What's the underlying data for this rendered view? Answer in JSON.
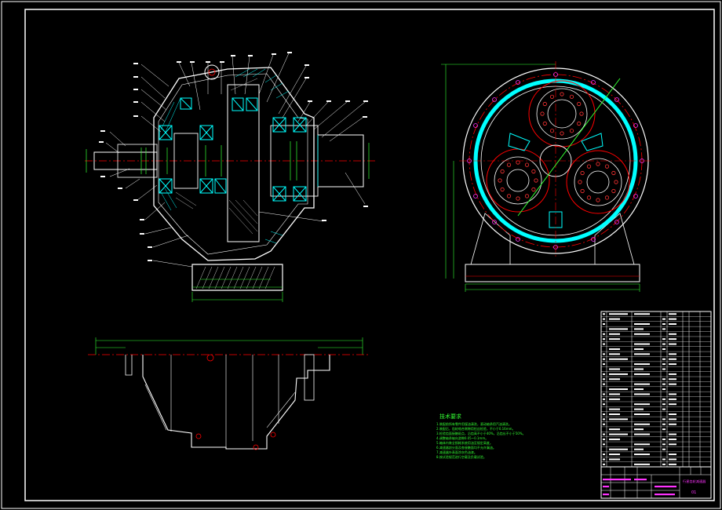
{
  "drawing": {
    "title_block_name": "行星齿轮减速器",
    "drawing_number": "01",
    "tech_title": "技术要求",
    "tech_notes": [
      "1.装配前所有零件用煤油清洗，滚动轴承用汽油清洗。",
      "2.装配后，齿轮啮合侧隙用铅丝检验，不小于0.16mm。",
      "3.检验齿面接触斑点，沿齿高不小于40%，沿齿长不小于50%。",
      "4.调整轴承轴向游隙0.05~0.1mm。",
      "5.箱体内装全损耗系统用油至规定高度。",
      "6.减速器剖分面及各接触面均不允许漏油。",
      "7.减速器外表面涂灰色油漆。",
      "8.按试验规范进行空载及负载试验。"
    ]
  },
  "colors": {
    "background": "#000000",
    "line": "#ffffff",
    "section": "#00ffff",
    "dimension": "#33ff33",
    "center": "#ff0000",
    "annotation": "#ff33ff"
  }
}
